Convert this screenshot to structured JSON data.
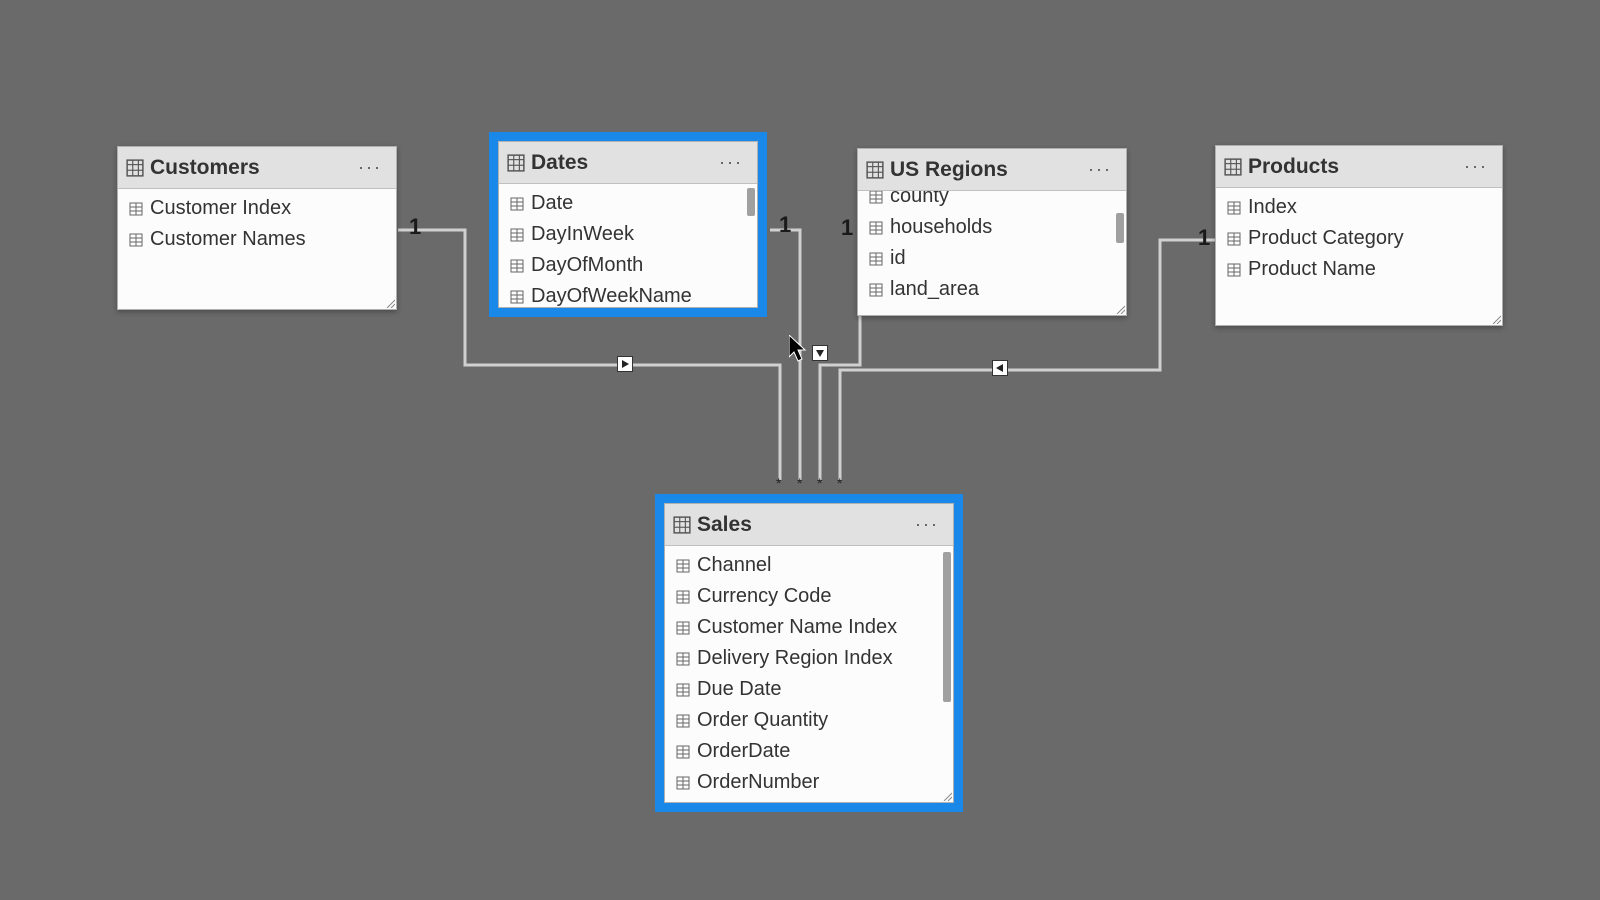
{
  "tables": {
    "customers": {
      "title": "Customers",
      "fields": [
        "Customer Index",
        "Customer Names"
      ]
    },
    "dates": {
      "title": "Dates",
      "fields": [
        "Date",
        "DayInWeek",
        "DayOfMonth",
        "DayOfWeekName"
      ]
    },
    "usregions": {
      "title": "US Regions",
      "fields": [
        "county",
        "households",
        "id",
        "land_area"
      ]
    },
    "products": {
      "title": "Products",
      "fields": [
        "Index",
        "Product Category",
        "Product Name"
      ]
    },
    "sales": {
      "title": "Sales",
      "fields": [
        "Channel",
        "Currency Code",
        "Customer Name Index",
        "Delivery Region Index",
        "Due Date",
        "Order Quantity",
        "OrderDate",
        "OrderNumber"
      ]
    }
  },
  "cardinality": {
    "one": "1",
    "many": "*"
  },
  "ellipsis": "···"
}
